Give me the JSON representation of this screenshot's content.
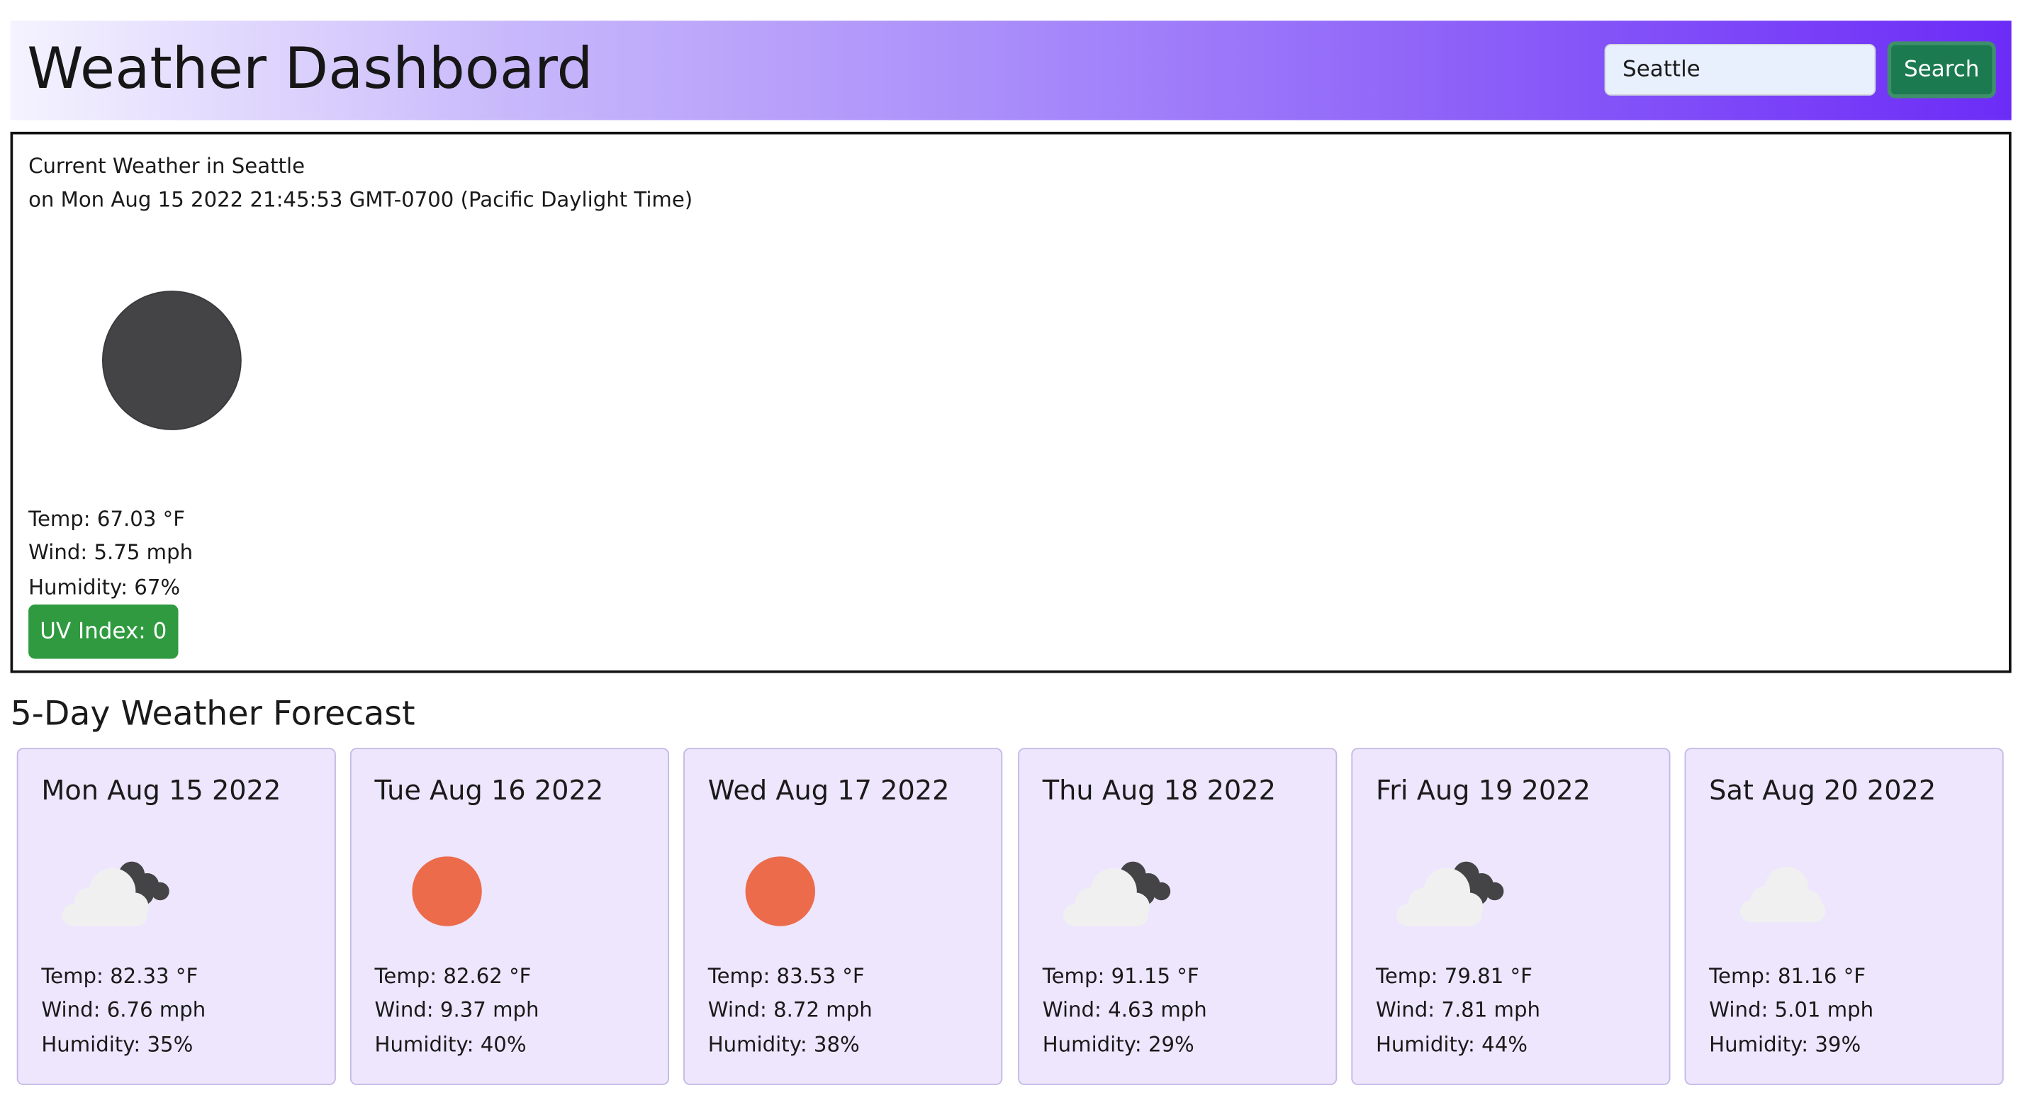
{
  "header": {
    "title": "Weather Dashboard",
    "search_value": "Seattle",
    "search_label": "Search"
  },
  "current": {
    "heading": "Current Weather in Seattle",
    "datetime": "on Mon Aug 15 2022 21:45:53 GMT-0700 (Pacific Daylight Time)",
    "icon": "night-clear-icon",
    "temp": "Temp: 67.03 °F",
    "wind": "Wind: 5.75 mph",
    "humidity": "Humidity: 67%",
    "uv_index": "UV Index: 0",
    "uv_color": "#2f9a3f"
  },
  "forecast": {
    "title": "5-Day Weather Forecast",
    "days": [
      {
        "date": "Mon Aug 15 2022",
        "icon": "partly-cloudy-night-icon",
        "temp": "Temp: 82.33 °F",
        "wind": "Wind: 6.76 mph",
        "humidity": "Humidity: 35%"
      },
      {
        "date": "Tue Aug 16 2022",
        "icon": "sun-icon",
        "temp": "Temp: 82.62 °F",
        "wind": "Wind: 9.37 mph",
        "humidity": "Humidity: 40%"
      },
      {
        "date": "Wed Aug 17 2022",
        "icon": "sun-icon",
        "temp": "Temp: 83.53 °F",
        "wind": "Wind: 8.72 mph",
        "humidity": "Humidity: 38%"
      },
      {
        "date": "Thu Aug 18 2022",
        "icon": "partly-cloudy-night-icon",
        "temp": "Temp: 91.15 °F",
        "wind": "Wind: 4.63 mph",
        "humidity": "Humidity: 29%"
      },
      {
        "date": "Fri Aug 19 2022",
        "icon": "partly-cloudy-night-icon",
        "temp": "Temp: 79.81 °F",
        "wind": "Wind: 7.81 mph",
        "humidity": "Humidity: 44%"
      },
      {
        "date": "Sat Aug 20 2022",
        "icon": "cloud-icon",
        "temp": "Temp: 81.16 °F",
        "wind": "Wind: 5.01 mph",
        "humidity": "Humidity: 39%"
      }
    ]
  },
  "colors": {
    "header_gradient_end": "#6c2cf7",
    "card_background": "#ede6fd",
    "search_button": "#1c7a50",
    "sun": "#ec6b4b",
    "moon": "#444346",
    "cloud": "#f0f0f0"
  }
}
